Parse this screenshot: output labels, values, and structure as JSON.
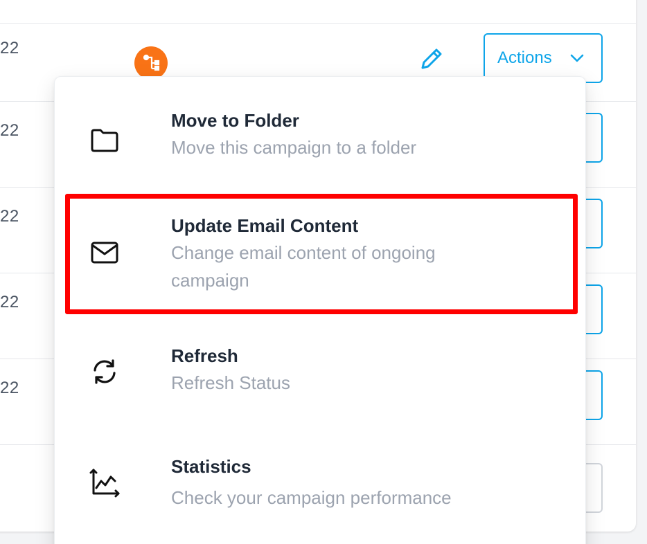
{
  "rows": [
    {
      "date": "22"
    },
    {
      "date": "22"
    },
    {
      "date": "22"
    },
    {
      "date": "22"
    },
    {
      "date": "22"
    }
  ],
  "actions_button": {
    "label": "Actions"
  },
  "menu": {
    "items": [
      {
        "title": "Move to Folder",
        "description": "Move this campaign to a folder",
        "icon": "folder-icon"
      },
      {
        "title": "Update Email Content",
        "description": "Change email content of ongoing campaign",
        "icon": "mail-icon"
      },
      {
        "title": "Refresh",
        "description": "Refresh Status",
        "icon": "refresh-icon"
      },
      {
        "title": "Statistics",
        "description": "Check your campaign performance",
        "icon": "chart-icon"
      }
    ],
    "highlighted_item": "Update Email Content"
  },
  "colors": {
    "accent": "#0ea5e9",
    "flow_badge": "#f97316",
    "highlight": "#ff0000",
    "title_text": "#1f2937",
    "desc_text": "#9ca3af"
  }
}
